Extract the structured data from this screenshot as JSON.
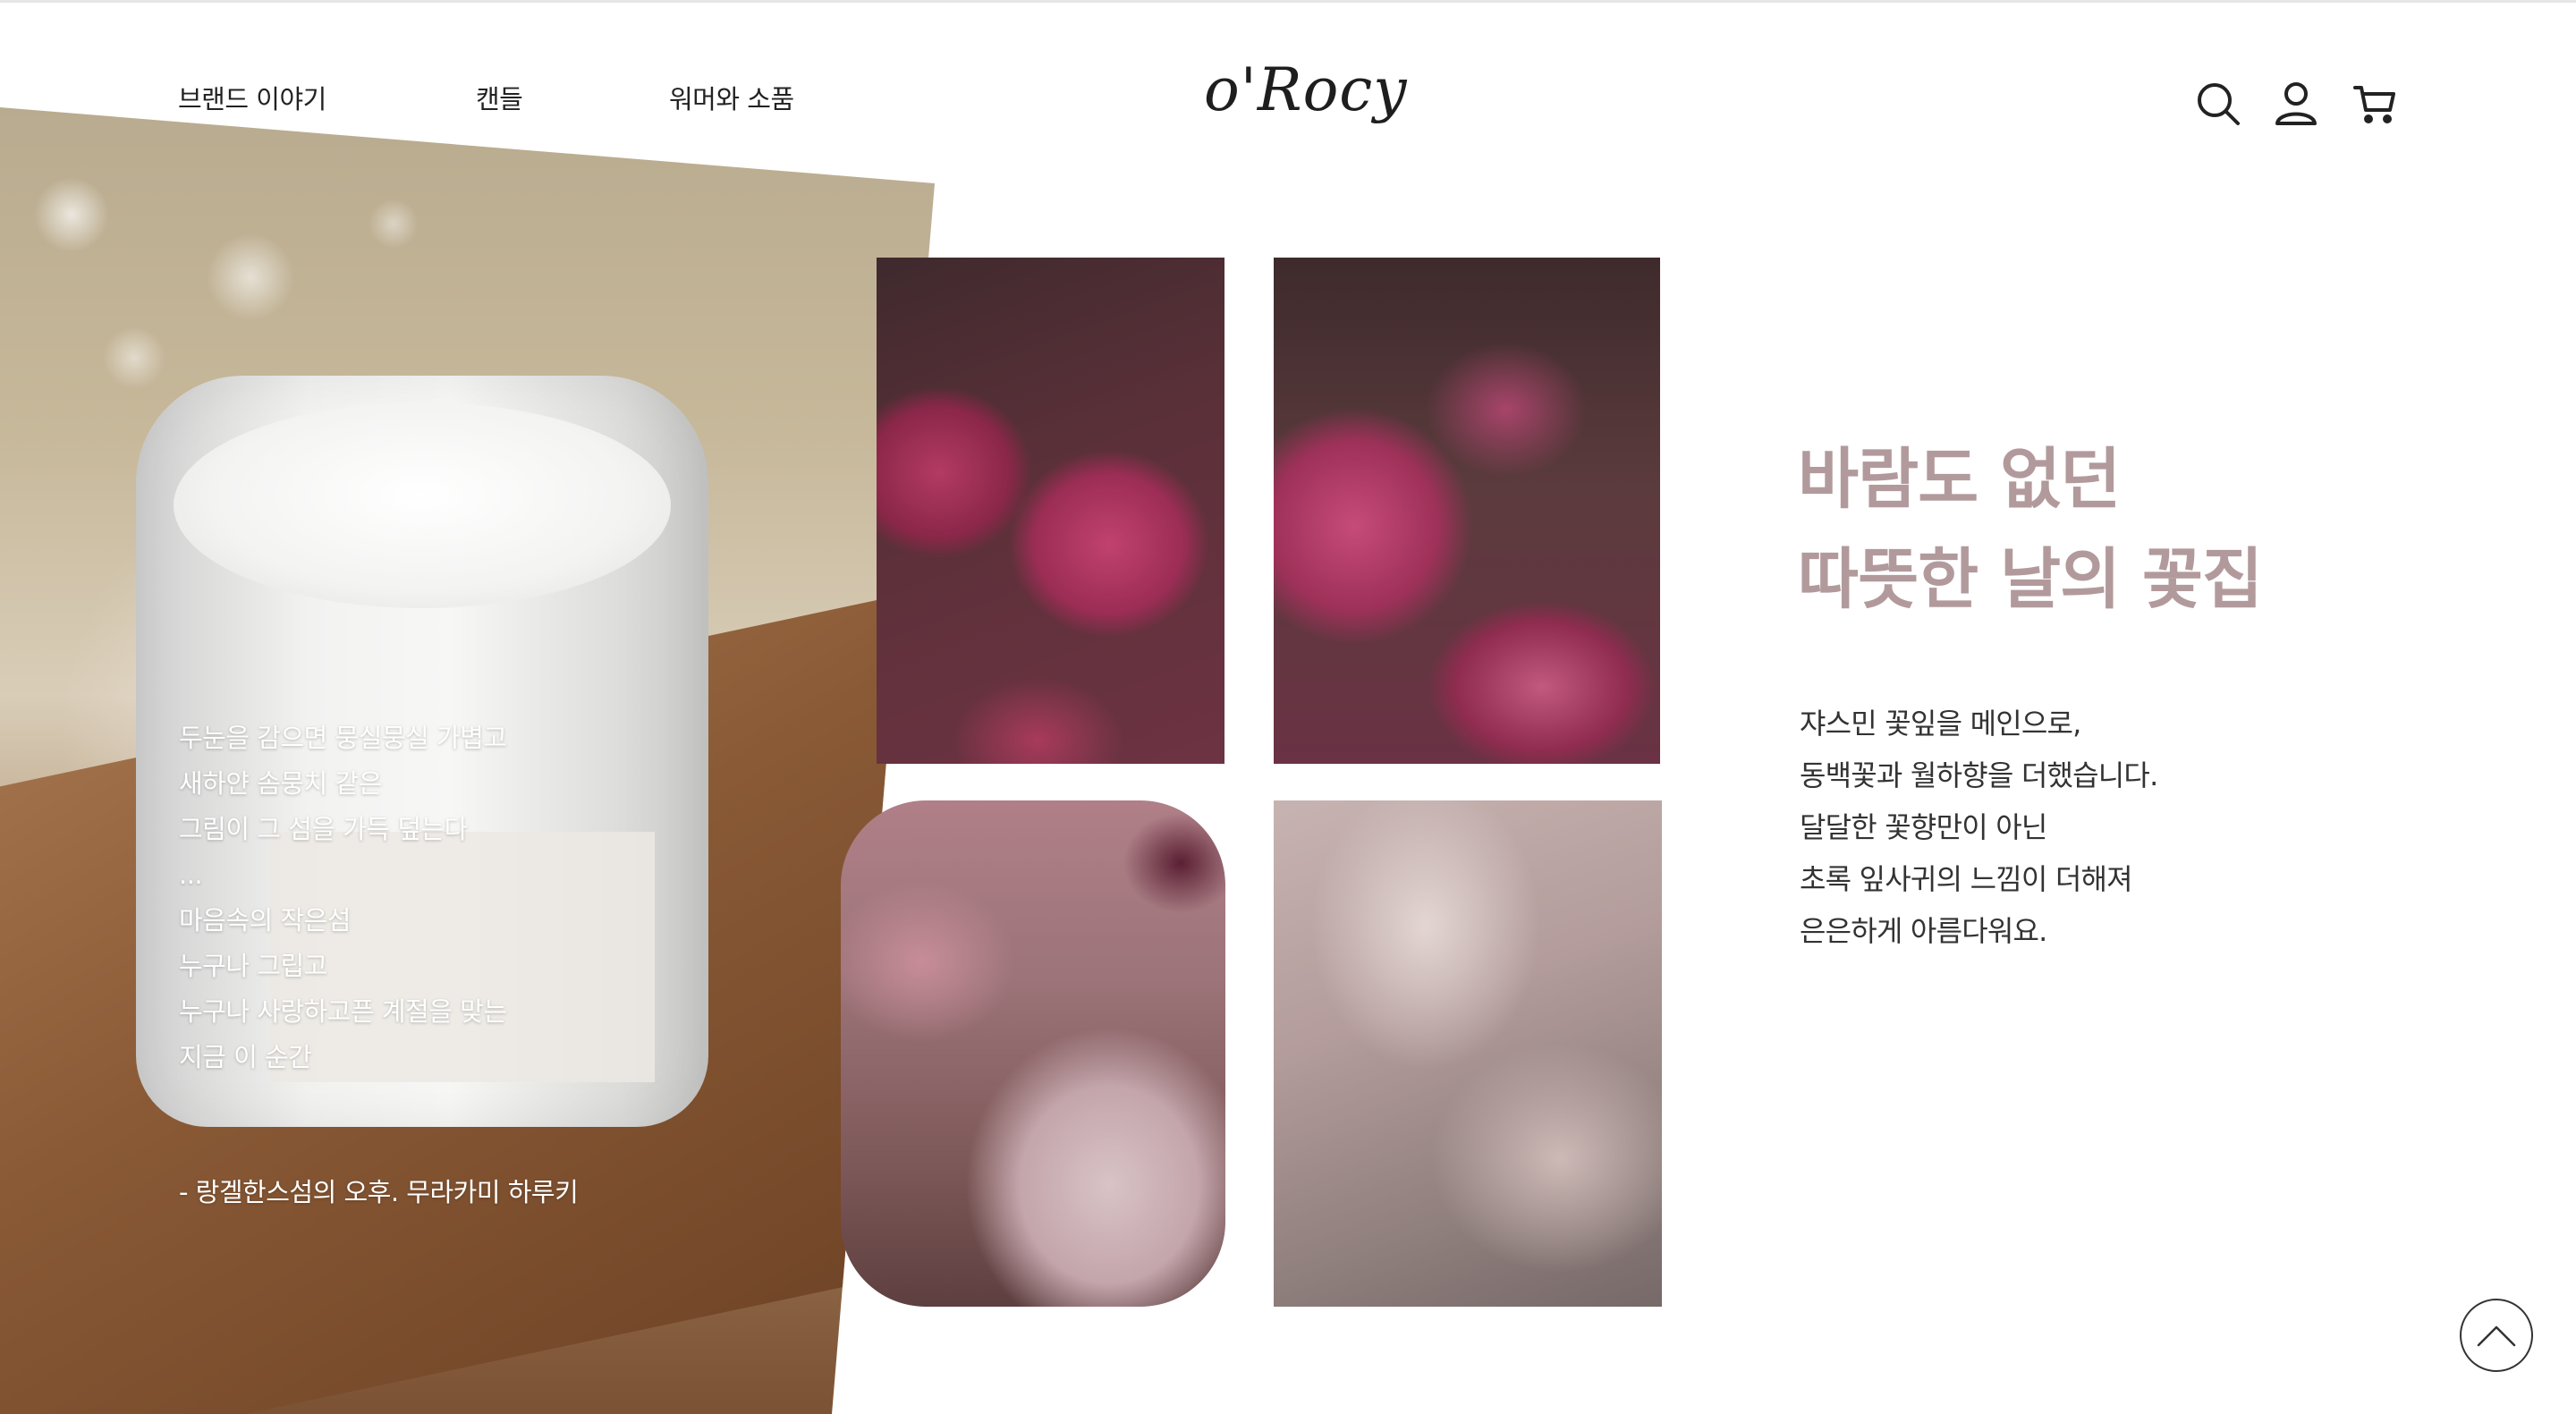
{
  "header": {
    "nav": [
      {
        "label": "브랜드 이야기"
      },
      {
        "label": "캔들"
      },
      {
        "label": "워머와 소품"
      }
    ],
    "logo": "o'Rocy",
    "icons": [
      "search-icon",
      "user-icon",
      "cart-icon"
    ]
  },
  "candle_panel": {
    "poem_lines": [
      "두눈을 감으면 뭉실뭉실 가볍고",
      "새하얀 솜뭉치 같은",
      "그림이 그 섬을 가득 덮는다",
      "...",
      "마음속의 작은섬",
      "누구나 그립고",
      "누구나 사랑하고픈 계절을 맞는",
      "지금 이 순간"
    ],
    "quote": "- 랑겔한스섬의 오후. 무라카미 하루키"
  },
  "feature": {
    "headline_lines": [
      "바람도 없던",
      "따뜻한 날의 꽃집"
    ],
    "description_lines": [
      "쟈스민 꽃잎을 메인으로,",
      "동백꽃과 월하향을 더했습니다.",
      "달달한 꽃향만이 아닌",
      "초록 잎사귀의 느낌이 더해져",
      "은은하게 아름다워요."
    ]
  },
  "colors": {
    "headline": "#b29a9c",
    "text": "#333333",
    "background": "#ffffff"
  },
  "scroll_top": {
    "icon": "chevron-up-icon"
  }
}
